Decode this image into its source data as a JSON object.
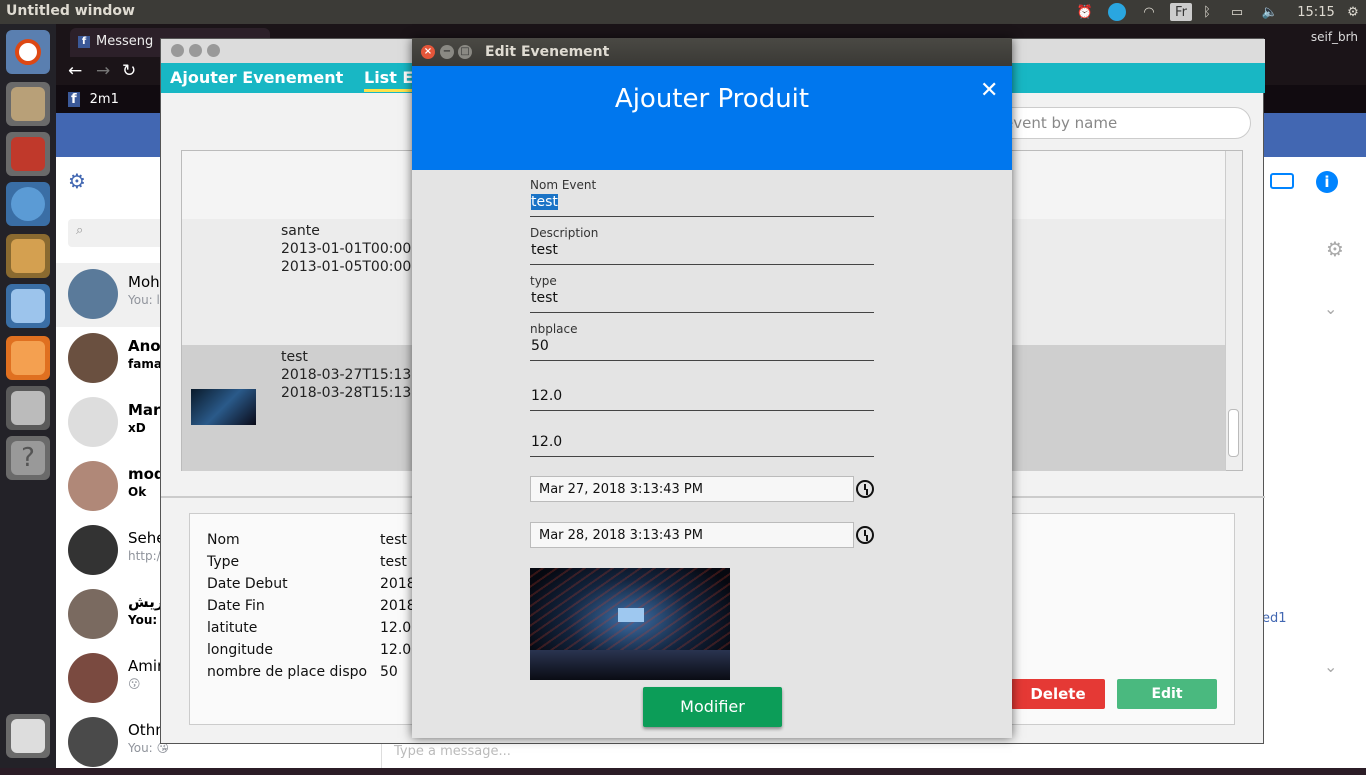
{
  "panel": {
    "title": "Untitled window",
    "lang": "Fr",
    "clock": "15:15"
  },
  "browser": {
    "tab_title": "Messeng",
    "user": "seif_brh",
    "bookmark": "2m1",
    "compose_placeholder": "Type a message...",
    "right_link": "ed1"
  },
  "messenger": {
    "search_placeholder": "",
    "conversations": [
      {
        "name": "Moha",
        "preview": "You: l"
      },
      {
        "name": "Anoi",
        "preview": "fama"
      },
      {
        "name": "Mari",
        "preview": "xD"
      },
      {
        "name": "mod",
        "preview": "Ok"
      },
      {
        "name": "Sehe",
        "preview": "http:/"
      },
      {
        "name": "يهريش",
        "preview": "You:"
      },
      {
        "name": "Amir",
        "preview": "😗"
      },
      {
        "name": "Othn",
        "preview": "You: 😘"
      }
    ]
  },
  "app": {
    "tabs": [
      "Ajouter Evenement",
      "List E"
    ],
    "search_placeholder": "event by name",
    "list": [
      {
        "line1": "sante",
        "line2": "2013-01-01T00:00",
        "line3": "2013-01-05T00:00"
      },
      {
        "line1": "test",
        "line2": "2018-03-27T15:13",
        "line3": "2018-03-28T15:13"
      }
    ],
    "detail": {
      "rows": [
        {
          "key": "Nom",
          "value": "test"
        },
        {
          "key": "Type",
          "value": "test"
        },
        {
          "key": "Date Debut",
          "value": "2018"
        },
        {
          "key": "Date Fin",
          "value": "2018"
        },
        {
          "key": "latitute",
          "value": "12.0"
        },
        {
          "key": "longitude",
          "value": "12.0"
        },
        {
          "key": "nombre de place dispo",
          "value": "50"
        }
      ]
    },
    "delete_label": "Delete",
    "edit_label": "Edit"
  },
  "dialog": {
    "window_title": "Edit Evenement",
    "heading": "Ajouter Produit",
    "close_glyph": "✕",
    "fields": {
      "nom_label": "Nom Event",
      "nom_value": "test",
      "desc_label": "Description",
      "desc_value": "test",
      "type_label": "type",
      "type_value": "test",
      "nb_label": "nbplace",
      "nb_value": "50",
      "lat_value": "12.0",
      "lon_value": "12.0"
    },
    "date_start": "Mar 27, 2018 3:13:43 PM",
    "date_end": "Mar 28, 2018 3:13:43 PM",
    "submit_label": "Modifier"
  }
}
